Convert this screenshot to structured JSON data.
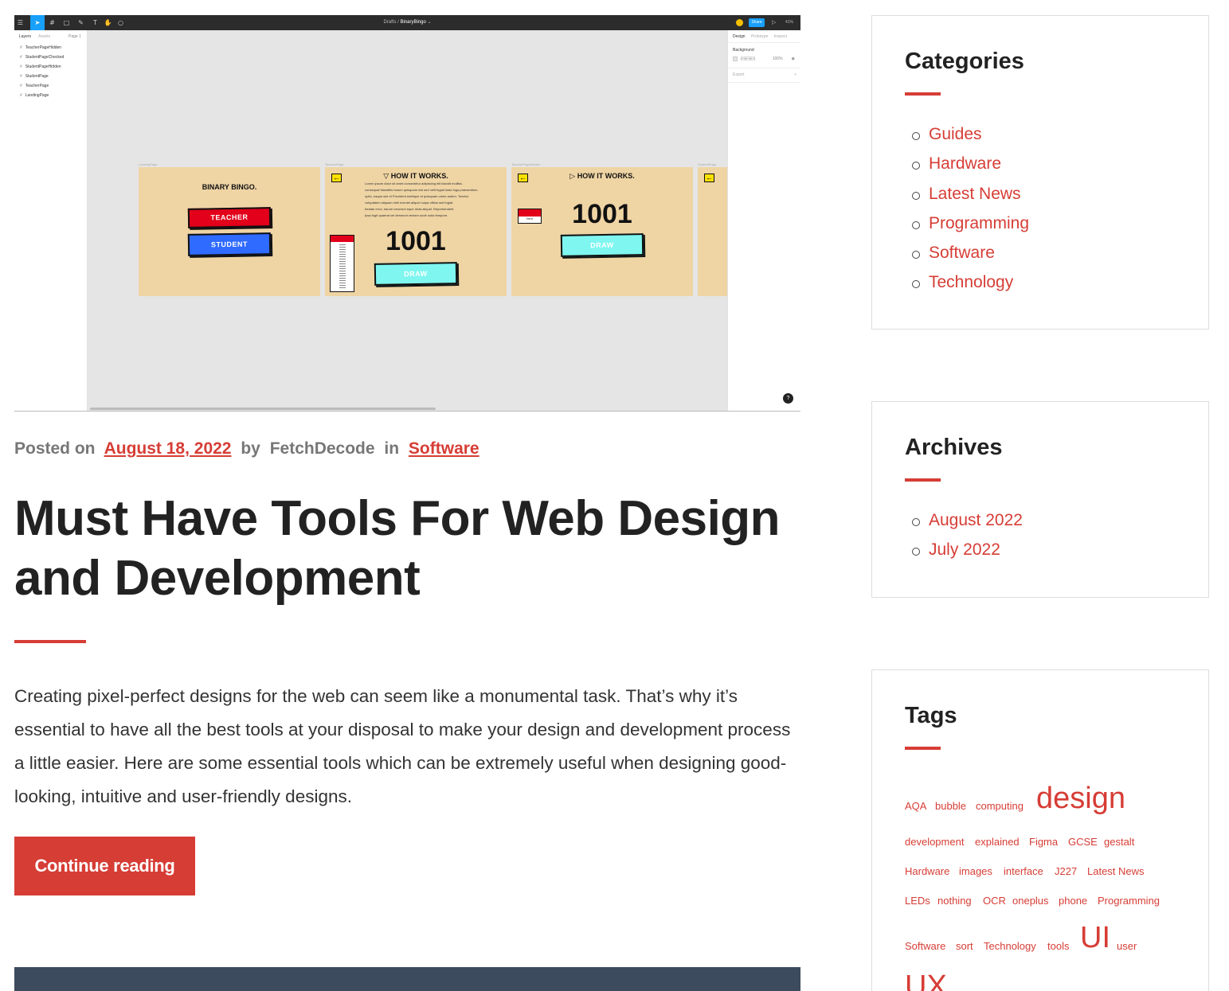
{
  "featured_image": {
    "app": {
      "file_path_prefix": "Drafts",
      "file_name": "BinaryBingo",
      "share_label": "Share",
      "zoom": "41%",
      "left_tabs": [
        "Layers",
        "Assets"
      ],
      "page_selector": "Page 1",
      "layers": [
        "TeacherPageHidden",
        "StudentPageChecked",
        "StudentPageHidden",
        "StudentPage",
        "TeacherPage",
        "LandingPage"
      ],
      "right_tabs": [
        "Design",
        "Prototype",
        "Inspect"
      ],
      "background_label": "Background",
      "background_hex": "E5E5E5",
      "background_opacity": "100%",
      "export_label": "Export",
      "help": "?"
    },
    "frames": {
      "landing_label": "LandingPage",
      "teacher_label": "TeacherPage",
      "teacher_hidden_label": "TeacherPageHidden",
      "student_label": "StudentPage",
      "game_title": "BINARY BINGO.",
      "teacher_btn": "TEACHER",
      "student_btn": "STUDENT",
      "how_it_works": "HOW IT WORKS.",
      "number": "1001",
      "draw_btn": "DRAW",
      "teacher_card_label": "Next",
      "lorem_lines": [
        "Lorem ipsum dolor sit amet consectetur adipiscing elit blandit mollitia.",
        "consequat blanditiis harum quisquam nisi sed velit fugiat iusto fuga praesentium.",
        "optio, eaque sint et Provident similique et quisquam omne autem. Tenetur",
        "voluptatem aliquam nihil eveniet aliquid culpa officia sed fugiat.",
        "beatae error, harum nescrunt eque dicta aliquid. Reprehenderit.",
        "Ipsa fugit quaerat vel deserunt veniam unde nulla tempore."
      ]
    }
  },
  "post": {
    "meta": {
      "posted_on": "Posted on",
      "date": "August 18, 2022",
      "by": "by",
      "author": "FetchDecode",
      "in": "in",
      "category": "Software"
    },
    "title": "Must Have Tools For Web Design and Development",
    "excerpt": "Creating pixel-perfect designs for the web can seem like a monumental task. That’s why it’s essential to have all the best tools at your disposal to make your design and development process a little easier. Here are some essential tools which can be extremely useful when designing good-looking, intuitive and user-friendly designs.",
    "continue_label": "Continue reading"
  },
  "sidebar": {
    "categories": {
      "title": "Categories",
      "items": [
        "Guides",
        "Hardware",
        "Latest News",
        "Programming",
        "Software",
        "Technology"
      ]
    },
    "archives": {
      "title": "Archives",
      "items": [
        "August 2022",
        "July 2022"
      ]
    },
    "tags": {
      "title": "Tags",
      "items": [
        "AQA",
        "bubble",
        "computing",
        "design",
        "development",
        "explained",
        "Figma",
        "GCSE",
        "gestalt",
        "Hardware",
        "images",
        "interface",
        "J227",
        "Latest News",
        "LEDs",
        "nothing",
        "OCR",
        "oneplus",
        "phone",
        "Programming",
        "Software",
        "sort",
        "Technology",
        "tools",
        "UI",
        "user",
        "UX"
      ]
    }
  },
  "colors": {
    "accent": "#d63d35",
    "text": "#222222",
    "muted": "#777777",
    "next_post_bar": "#3c4b5e"
  }
}
